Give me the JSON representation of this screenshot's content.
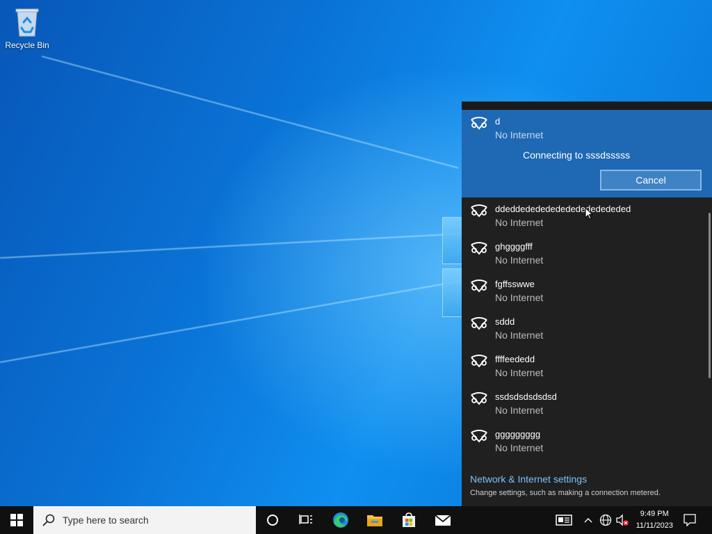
{
  "desktop": {
    "recycle_bin_label": "Recycle Bin"
  },
  "network_flyout": {
    "active": {
      "name": "d",
      "status": "No Internet",
      "connecting_text": "Connecting to sssdsssss",
      "cancel_label": "Cancel"
    },
    "networks": [
      {
        "name": "ddeddededededededededededed",
        "status": "No Internet"
      },
      {
        "name": "ghggggfff",
        "status": "No Internet"
      },
      {
        "name": "fgffsswwe",
        "status": "No Internet"
      },
      {
        "name": "sddd",
        "status": "No Internet"
      },
      {
        "name": "ffffeededd",
        "status": "No Internet"
      },
      {
        "name": "ssdsdsdsdsdsd",
        "status": "No Internet"
      },
      {
        "name": "ggggggggg",
        "status": "No Internet"
      }
    ],
    "settings_link": "Network & Internet settings",
    "settings_sub": "Change settings, such as making a connection metered."
  },
  "taskbar": {
    "search_placeholder": "Type here to search",
    "time": "9:49 PM",
    "date": "11/11/2023"
  },
  "colors": {
    "accent": "#1f68b3",
    "link": "#7fc1f7",
    "flyout_bg": "#202020",
    "taskbar_bg": "#101010"
  }
}
